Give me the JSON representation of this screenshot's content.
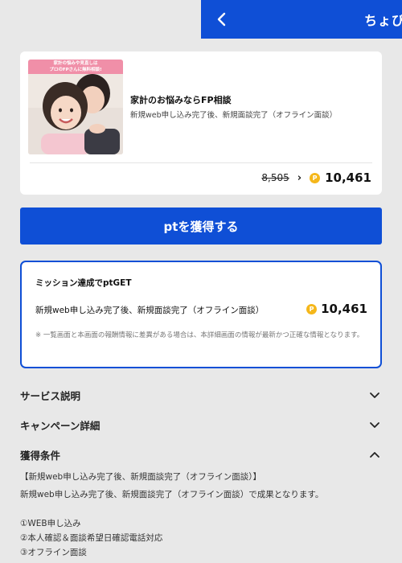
{
  "header": {
    "title": "ちょびリッチ",
    "back_icon": "chevron-left-icon",
    "color": "#0f4fd6"
  },
  "offer": {
    "image_banner": "家計の悩みや見直しは\nプロのFPさんに無料相談!",
    "title": "家計のお悩みならFP相談",
    "description": "新規web申し込み完了後、新規面談完了（オフライン面談）",
    "old_points": "8,505",
    "new_points": "10,461",
    "coin_icon": "point-coin-icon",
    "coin_letter": "P"
  },
  "cta": {
    "label": "ptを獲得する"
  },
  "mission": {
    "title": "ミッション達成でptGET",
    "condition": "新規web申し込み完了後、新規面談完了（オフライン面談）",
    "points": "10,461",
    "note": "※ 一覧画面と本画面の報酬情報に差異がある場合は、本詳細画面の情報が最新かつ正確な情報となります。"
  },
  "sections": [
    {
      "label": "サービス説明",
      "expanded": false
    },
    {
      "label": "キャンペーン詳細",
      "expanded": false
    },
    {
      "label": "獲得条件",
      "expanded": true
    }
  ],
  "conditions": {
    "heading": "【新規web申し込み完了後、新規面談完了（オフライン面談）】",
    "summary": "新規web申し込み完了後、新規面談完了（オフライン面談）で成果となります。",
    "steps": [
      "①WEB申し込み",
      "②本人確認＆面談希望日確認電話対応",
      "③オフライン面談"
    ]
  }
}
